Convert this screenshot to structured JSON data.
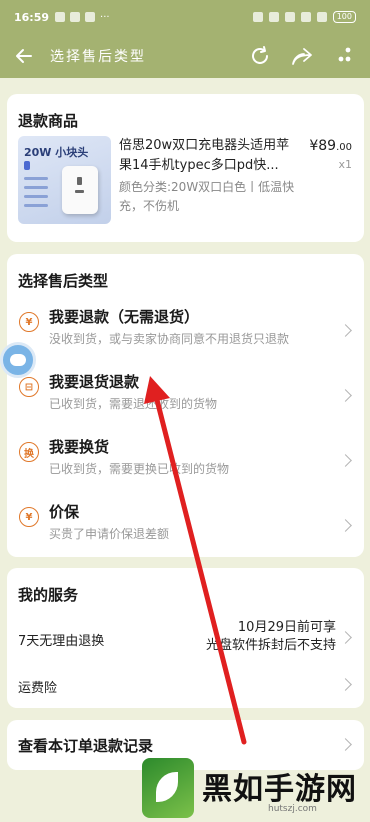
{
  "status_bar": {
    "time": "16:59",
    "battery": "100"
  },
  "header": {
    "title": "选择售后类型"
  },
  "product_section": {
    "title": "退款商品",
    "thumb_title": "20W 小块头",
    "name": "倍思20w双口充电器头适用苹果14手机typec多口pd快...",
    "spec": "颜色分类:20W双口白色丨低温快充，不伤机",
    "price_symbol": "¥",
    "price_main": "89",
    "price_decimal": ".00",
    "quantity": "x1"
  },
  "types_section": {
    "title": "选择售后类型",
    "items": [
      {
        "icon": "¥",
        "name": "我要退款（无需退货）",
        "desc": "没收到货，或与卖家协商同意不用退货只退款"
      },
      {
        "icon": "⊟",
        "name": "我要退货退款",
        "desc": "已收到货，需要退还收到的货物"
      },
      {
        "icon": "换",
        "name": "我要换货",
        "desc": "已收到货，需要更换已收到的货物"
      },
      {
        "icon": "¥",
        "name": "价保",
        "desc": "买贵了申请价保退差额"
      }
    ]
  },
  "services_section": {
    "title": "我的服务",
    "rows": [
      {
        "label": "7天无理由退换",
        "value_line1": "10月29日前可享",
        "value_line2": "光盘软件拆封后不支持"
      },
      {
        "label": "运费险"
      }
    ]
  },
  "records": {
    "title": "查看本订单退款记录"
  },
  "watermark": {
    "text": "黑如手游网",
    "url": "hutszj.com"
  },
  "colors": {
    "header_bg": "#a4b271",
    "page_bg": "#eef0dc",
    "icon_accent": "#e0782a",
    "annotation_arrow": "#e02020"
  },
  "icons": {
    "back": "arrow-left-icon",
    "refresh": "refresh-icon",
    "share": "share-icon",
    "more": "more-dots-icon"
  }
}
